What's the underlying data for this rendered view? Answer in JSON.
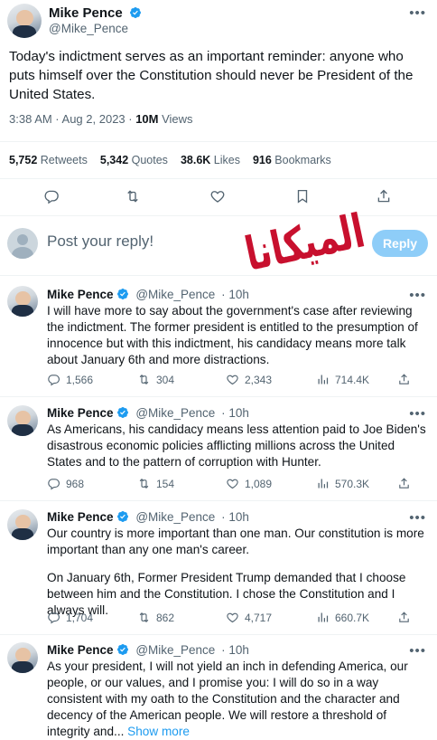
{
  "main_tweet": {
    "display_name": "Mike Pence",
    "handle": "@Mike_Pence",
    "text": "Today's indictment serves as an important reminder: anyone who puts himself over the Constitution should never be President of the United States.",
    "time": "3:38 AM · Aug 2, 2023 · ",
    "views": "10M",
    "views_label": " Views",
    "stats": [
      {
        "count": "5,752",
        "label": " Retweets"
      },
      {
        "count": "5,342",
        "label": " Quotes"
      },
      {
        "count": "38.6K",
        "label": " Likes"
      },
      {
        "count": "916",
        "label": " Bookmarks"
      }
    ]
  },
  "compose": {
    "placeholder": "Post your reply!",
    "button_label": "Reply"
  },
  "watermark": {
    "text": "الميكانا",
    "color": "#c8102e"
  },
  "colors": {
    "accent": "#1d9bf0",
    "muted": "#536471"
  },
  "replies": [
    {
      "display_name": "Mike Pence",
      "handle": "@Mike_Pence",
      "time": "· 10h",
      "text": "I will have more to say about the government's case after reviewing the indictment. The former president is entitled to the presumption of innocence but with this indictment, his candidacy means more talk about January 6th and more distractions.",
      "replies": "1,566",
      "retweets": "304",
      "likes": "2,343",
      "views": "714.4K"
    },
    {
      "display_name": "Mike Pence",
      "handle": "@Mike_Pence",
      "time": "· 10h",
      "text": "As Americans, his candidacy means less attention paid to Joe Biden's disastrous economic policies afflicting millions across the United States and to the pattern of corruption with Hunter.",
      "replies": "968",
      "retweets": "154",
      "likes": "1,089",
      "views": "570.3K"
    },
    {
      "display_name": "Mike Pence",
      "handle": "@Mike_Pence",
      "time": "· 10h",
      "text": "Our country is more important than one man. Our constitution is more important than any one man's career.",
      "text2": "On January 6th, Former President Trump demanded that I choose between him and the Constitution. I chose the Constitution and I always will.",
      "replies": "1,704",
      "retweets": "862",
      "likes": "4,717",
      "views": "660.7K"
    },
    {
      "display_name": "Mike Pence",
      "handle": "@Mike_Pence",
      "time": "· 10h",
      "text": "As your president, I will not yield an inch in defending America, our people, or our values, and I promise you: I will do so in a way consistent with my oath to the Constitution and the character and decency of the American people. We will restore a threshold of integrity and... ",
      "show_more": "Show more"
    }
  ]
}
